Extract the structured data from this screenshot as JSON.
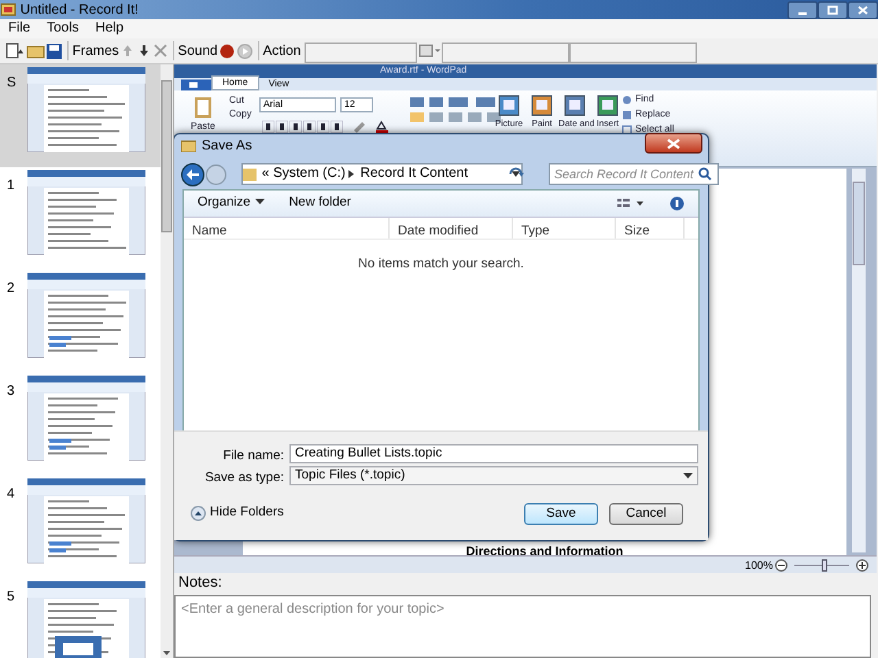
{
  "window": {
    "title": "Untitled - Record It!"
  },
  "menu": [
    {
      "label": "File"
    },
    {
      "label": "Tools"
    },
    {
      "label": "Help"
    }
  ],
  "toolbar": {
    "frames_label": "Frames",
    "sound_label": "Sound",
    "action_label": "Action"
  },
  "frames": [
    {
      "label": "S",
      "selected": true
    },
    {
      "label": "1",
      "selected": false
    },
    {
      "label": "2",
      "selected": false
    },
    {
      "label": "3",
      "selected": false
    },
    {
      "label": "4",
      "selected": false
    },
    {
      "label": "5",
      "selected": false
    }
  ],
  "recording": {
    "app_title": "Award.rtf - WordPad",
    "tabs": [
      {
        "label": "Home",
        "selected": true
      },
      {
        "label": "View",
        "selected": false
      }
    ],
    "ribbon": {
      "paste": "Paste",
      "cut": "Cut",
      "copy": "Copy",
      "font": "Arial",
      "size": "12",
      "insert": [
        "Picture",
        "Paint",
        "Date and",
        "Insert"
      ],
      "find": "Find",
      "replace": "Replace",
      "select_all": "Select all"
    },
    "document_heading": "Directions and Information",
    "zoom": {
      "reading": "100%",
      "level": 0.55
    }
  },
  "dialog": {
    "title": "Save As",
    "breadcrumb_overflow": "«",
    "breadcrumb": [
      "System (C:)",
      "Record It Content"
    ],
    "search": {
      "placeholder": "Search Record It Content"
    },
    "organize": "Organize",
    "new_folder": "New folder",
    "columns": [
      "Name",
      "Date modified",
      "Type",
      "Size"
    ],
    "empty_message": "No items match your search.",
    "file_name": {
      "label": "File name:",
      "value": "Creating Bullet Lists.topic"
    },
    "save_type": {
      "label": "Save as type:",
      "value": "Topic Files (*.topic)"
    },
    "hide_folders": "Hide Folders",
    "buttons": [
      {
        "label": "Save",
        "default": true
      },
      {
        "label": "Cancel",
        "default": false
      }
    ]
  },
  "notes": {
    "label": "Notes:",
    "placeholder": "<Enter a general description for your topic>"
  }
}
